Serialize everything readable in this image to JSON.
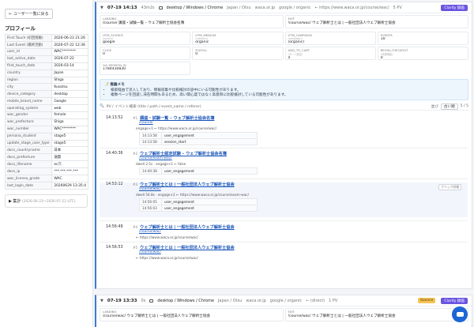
{
  "sidebar": {
    "back_label": "← ユーザー一覧に戻る",
    "profile_title": "プロフィール",
    "rows": [
      {
        "k": "First Touch (初回接触)",
        "v": "2026-06-23 21:26"
      },
      {
        "k": "Last Event (最終活動)",
        "v": "2026-07-22 12:36"
      },
      {
        "k": "user_id",
        "v": "WAC********"
      },
      {
        "k": "last_active_date",
        "v": "2026-07-22"
      },
      {
        "k": "first_touch_date",
        "v": "2026-03-14"
      },
      {
        "k": "country",
        "v": "Japan"
      },
      {
        "k": "region",
        "v": "Shiga"
      },
      {
        "k": "city",
        "v": "Kusatsu"
      },
      {
        "k": "device_category",
        "v": "desktop"
      },
      {
        "k": "mobile_brand_name",
        "v": "Google"
      },
      {
        "k": "operating_system",
        "v": "web"
      },
      {
        "k": "wac_gender",
        "v": "female"
      },
      {
        "k": "wac_prefecture",
        "v": "Shiga"
      },
      {
        "k": "wac_number",
        "v": "WAC********"
      },
      {
        "k": "persona_student",
        "v": "stage5"
      },
      {
        "k": "update_stage_user_type",
        "v": "stage5"
      },
      {
        "k": "docs_countryname",
        "v": "日本"
      },
      {
        "k": "docs_prefecture",
        "v": "滋賀"
      },
      {
        "k": "docs_lifename",
        "v": "ec只"
      },
      {
        "k": "docs_ip",
        "v": "***.***.***.***"
      },
      {
        "k": "wac_license_grade",
        "v": "WAC"
      },
      {
        "k": "last_login_date",
        "v": "20260629 13:35:4"
      }
    ],
    "agg_label": "▶ 集計",
    "agg_range": "(2026-06-23〜2026-07-22 UTC)"
  },
  "session1": {
    "date": "07-19 14:13",
    "duration": "43m2s",
    "device": "desktop / Windows / Chrome",
    "geo": "Japan / Otsu",
    "host": "waca.or.jp",
    "source": "google / organic",
    "landing_url": "← https://www.waca.or.jp/course/wac/",
    "pv": "5 PV",
    "clarity": "Clarity 録画",
    "fields": [
      {
        "label": "LANDING",
        "sub": "",
        "value": "/course/ 講座・試験一覧 – ウェブ解析士協会名簿"
      },
      {
        "label": "EXIT",
        "sub": "",
        "value": "/course/wac/ ウェブ解析士とは | 一般社団法人ウェブ解析士協会"
      },
      {
        "label": "UTM_SOURCE",
        "sub": "(source)",
        "value": "google"
      },
      {
        "label": "UTM_MEDIUM",
        "sub": "(medium)",
        "value": "organic"
      },
      {
        "label": "UTM_CAMPAIGN",
        "sub": "(campaign)",
        "value": "(organic)"
      },
      {
        "label": "EVENTS",
        "sub": "",
        "value": "10"
      },
      {
        "label": "CLICK",
        "sub": "",
        "value": "0"
      },
      {
        "label": "SCROLL",
        "sub": "",
        "value": "0"
      },
      {
        "label": "ADD_TO_CART",
        "sub": "(カート追加)",
        "value": "0"
      },
      {
        "label": "BEGIN_CHECKOUT",
        "sub": "(決済開始)",
        "value": "0"
      },
      {
        "label": "GA_SESSION_ID",
        "sub": "",
        "value": "1784430830"
      }
    ],
    "memo_title": "📝 推論メモ",
    "memo_items": [
      "検索経由で流入しており、情報収集や比較検討の途中にいる可能性があります。",
      "複数ページを回遊し滞在時間もあるため、高い関心度ではなく高意目に比較検討している可能性があります。"
    ],
    "search_placeholder": "PV / イベント検索 (title / path / event_name / referer)",
    "sort_label": "並び",
    "sort_value": "古い順",
    "page_count": "5 / 5",
    "events": [
      {
        "time": "14:13:52",
        "num": "#1",
        "title": "講座・試験一覧 – ウェブ解析士協会名簿",
        "path": "/course/",
        "line": "engage×1 ← https://www.waca.or.jp/course/wac/",
        "subs": [
          {
            "t": "14:13:58",
            "n": "user_engagement"
          },
          {
            "t": "14:13:58",
            "n": "session_start"
          }
        ]
      },
      {
        "time": "14:40:36",
        "num": "#2",
        "title": "ウェブ解析士認定試験 – ウェブ解析士協会名簿",
        "path": "/course/exam-wac/",
        "line": "dwell 2.5s · engage×1 ← false",
        "subs": [
          {
            "t": "14:40:38",
            "n": "user_engagement"
          }
        ]
      },
      {
        "time": "14:53:12",
        "num": "#3",
        "title": "ウェブ解析士とは | 一般社団法人ウェブ解析士協会",
        "path": "/course/wac/",
        "line": "dwell 54.8s · engage×2 ← https://www.waca.or.jp/course/exam-wac/",
        "tag": "クリック詳細",
        "subs": [
          {
            "t": "14:56:05",
            "n": "user_engagement"
          },
          {
            "t": "14:56:03",
            "n": "user_engagement"
          }
        ]
      },
      {
        "time": "14:56:49",
        "num": "#4",
        "title": "ウェブ解析士とは | 一般社団法人ウェブ解析士協会",
        "path": "/course/wac/",
        "line": "← https://www.waca.or.jp/course/wac/",
        "subs": []
      },
      {
        "time": "14:56:53",
        "num": "#5",
        "title": "ウェブ解析士とは | 一般社団法人ウェブ解析士協会",
        "path": "/course/wac/",
        "line": "← https://www.waca.or.jp/course/wac/",
        "subs": []
      }
    ]
  },
  "session2": {
    "date": "07-19 13:33",
    "duration": "0s",
    "device": "desktop / Windows / Chrome",
    "geo": "Japan / Otsu",
    "host": "waca.or.jp",
    "source": "google / organic",
    "landing_url": "← (direct)",
    "pv": "1 PV",
    "bounce": "bounce",
    "clarity": "Clarity 録画",
    "fields": [
      {
        "label": "LANDING",
        "sub": "",
        "value": "/course/wac/ ウェブ解析士とは | 一般社団法人ウェブ解析士協会"
      },
      {
        "label": "EXIT",
        "sub": "",
        "value": "/course/wac/ ウェブ解析士とは | 一般社団法人ウェブ解析士協会"
      }
    ]
  },
  "colors": {
    "accent": "#3a7bd5",
    "clarity": "#6a55e0",
    "link": "#1a55b8"
  },
  "icons": {
    "chat": "chat-icon",
    "chevron": "chevron-down-icon"
  }
}
